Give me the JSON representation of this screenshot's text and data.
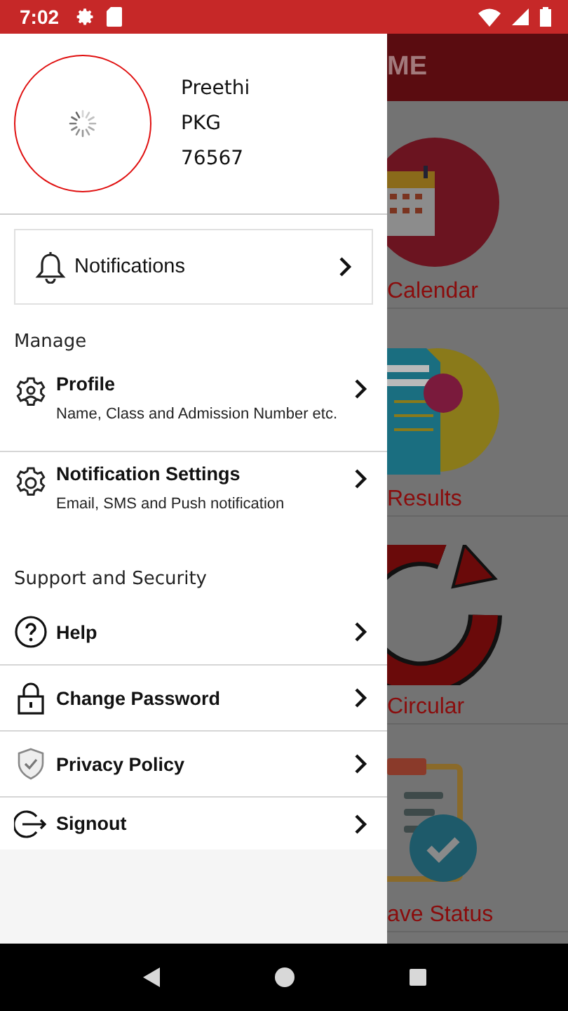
{
  "status_bar": {
    "time": "7:02"
  },
  "app_bar": {
    "title": "ME"
  },
  "tiles": [
    {
      "kind": "calendar",
      "label": "Calendar"
    },
    {
      "kind": "results",
      "label": "Results"
    },
    {
      "kind": "circular",
      "label": "Circular"
    },
    {
      "kind": "leave",
      "label": "ave Status"
    }
  ],
  "drawer": {
    "profile": {
      "name": "Preethi",
      "class": "PKG",
      "admission_number": "76567"
    },
    "notifications": {
      "label": "Notifications"
    },
    "sections": [
      {
        "heading": "Manage",
        "items": [
          {
            "kind": "profile",
            "title": "Profile",
            "subtitle": "Name, Class and Admission Number etc."
          },
          {
            "kind": "settings",
            "title": "Notification Settings",
            "subtitle": "Email, SMS and Push notification"
          }
        ]
      },
      {
        "heading": "Support and Security",
        "items": [
          {
            "kind": "help",
            "title": "Help"
          },
          {
            "kind": "password",
            "title": "Change Password"
          },
          {
            "kind": "privacy",
            "title": "Privacy Policy"
          },
          {
            "kind": "signout",
            "title": "Signout"
          }
        ]
      }
    ]
  }
}
